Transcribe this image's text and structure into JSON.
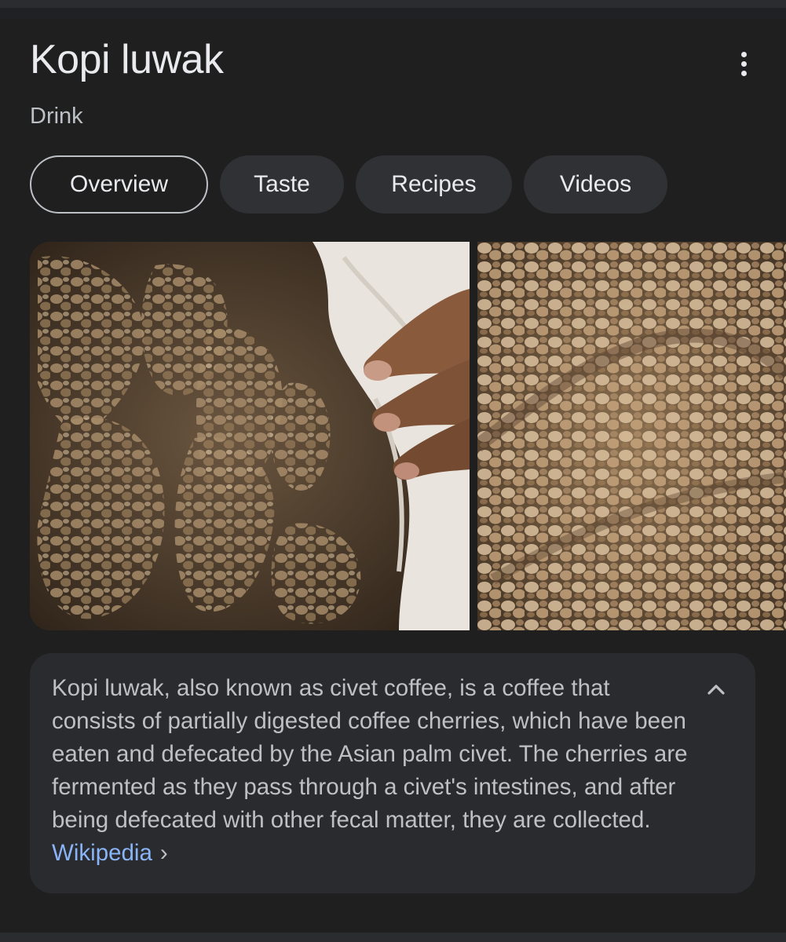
{
  "entity": {
    "title": "Kopi luwak",
    "subtitle": "Drink"
  },
  "menu": {
    "more_options_icon": "more-vert-icon"
  },
  "tabs": [
    {
      "label": "Overview",
      "selected": true
    },
    {
      "label": "Taste",
      "selected": false
    },
    {
      "label": "Recipes",
      "selected": false
    },
    {
      "label": "Videos",
      "selected": false
    }
  ],
  "images": [
    {
      "subject": "civet coffee bean clusters held by hand"
    },
    {
      "subject": "civet coffee bean clusters"
    }
  ],
  "description": {
    "text": "Kopi luwak, also known as civet coffee, is a coffee that consists of partially digested coffee cherries, which have been eaten and defecated by the Asian palm civet. The cherries are fermented as they pass through a civet's intestines, and after being defecated with other fecal matter, they are collected.",
    "source_label": "Wikipedia",
    "source_chevron": "›",
    "collapse_icon": "chevron-up-icon"
  },
  "colors": {
    "background": "#1f1f1f",
    "chip_background": "#303134",
    "description_background": "#2a2b2e",
    "link": "#8ab4f8",
    "primary_text": "#e8eaed",
    "secondary_text": "#bdc1c6"
  }
}
